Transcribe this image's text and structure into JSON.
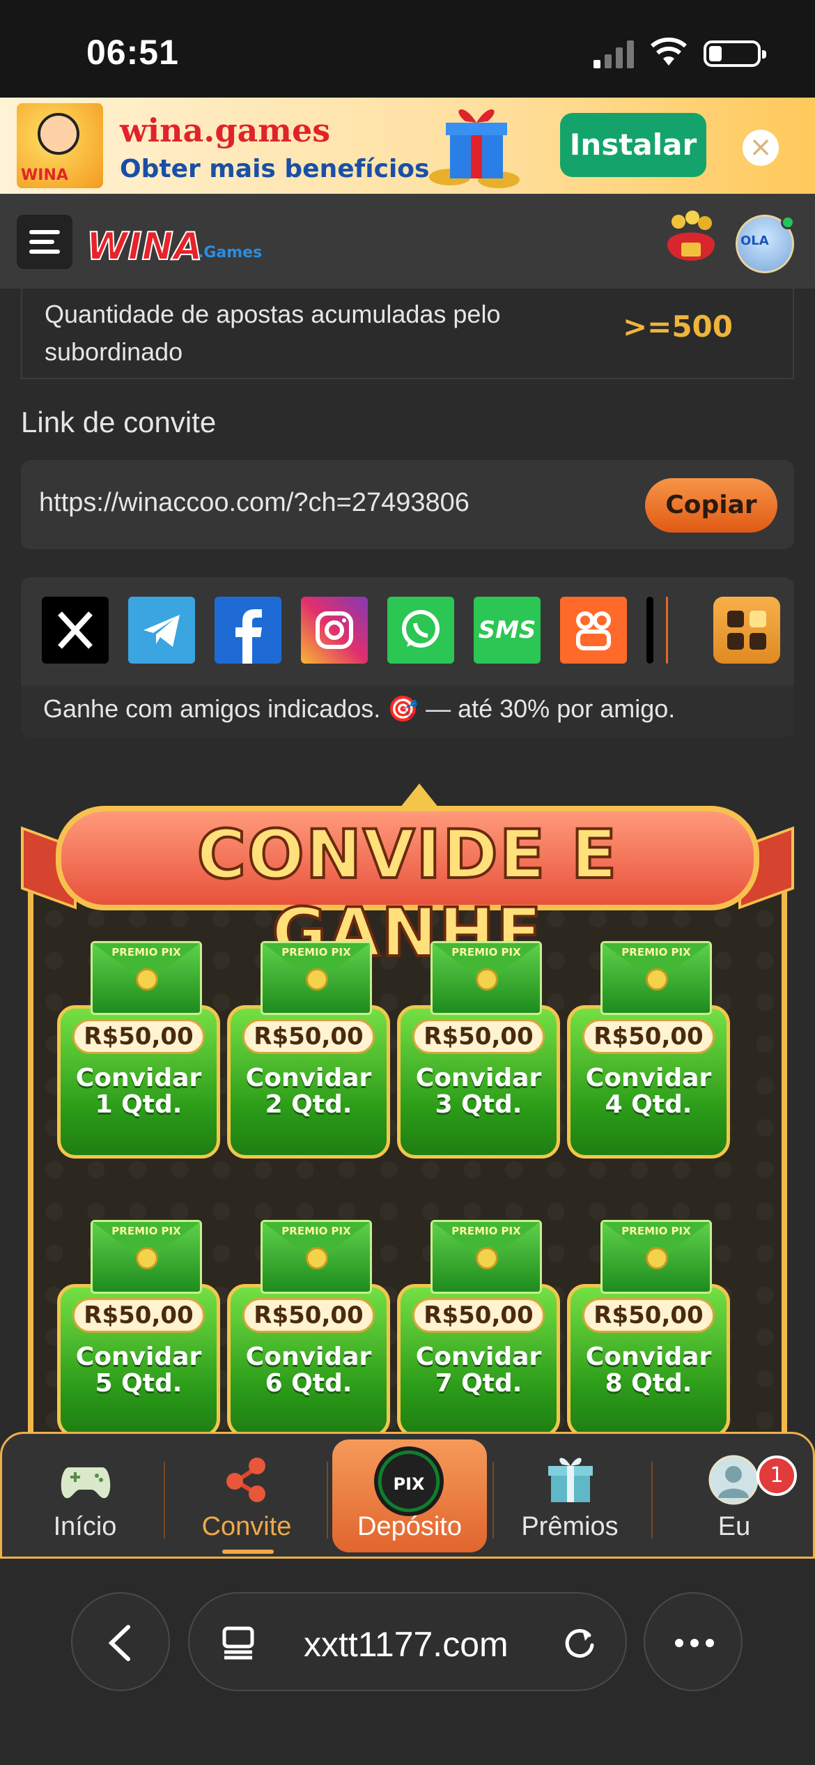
{
  "status_bar": {
    "time": "06:51"
  },
  "install_banner": {
    "app_name": "wina.games",
    "subtitle": "Obter mais benefícios",
    "install_label": "Instalar",
    "close_glyph": "×",
    "logo_text": "WINA"
  },
  "header": {
    "logo_text": "WINA",
    "logo_sub": ".Games",
    "avatar_text": "OLA"
  },
  "requirement": {
    "label": "Quantidade de apostas acumuladas pelo subordinado",
    "value": ">=500"
  },
  "invite_link": {
    "label": "Link de convite",
    "url": "https://winaccoo.com/?ch=27493806",
    "copy_label": "Copiar"
  },
  "share": {
    "icons": [
      "x-icon",
      "telegram-icon",
      "facebook-icon",
      "instagram-icon",
      "whatsapp-icon",
      "sms-icon",
      "kwai-icon",
      "more-apps-icon"
    ],
    "sms_text": "SMS",
    "caption": "Ganhe com amigos indicados. 🎯 — até 30% por amigo."
  },
  "promo": {
    "title": "CONVIDE E GANHE",
    "envelope_label": "PREMIO PIX",
    "prizes": [
      {
        "amount": "R$50,00",
        "line1": "Convidar",
        "line2": "1 Qtd."
      },
      {
        "amount": "R$50,00",
        "line1": "Convidar",
        "line2": "2 Qtd."
      },
      {
        "amount": "R$50,00",
        "line1": "Convidar",
        "line2": "3 Qtd."
      },
      {
        "amount": "R$50,00",
        "line1": "Convidar",
        "line2": "4 Qtd."
      },
      {
        "amount": "R$50,00",
        "line1": "Convidar",
        "line2": "5 Qtd."
      },
      {
        "amount": "R$50,00",
        "line1": "Convidar",
        "line2": "6 Qtd."
      },
      {
        "amount": "R$50,00",
        "line1": "Convidar",
        "line2": "7 Qtd."
      },
      {
        "amount": "R$50,00",
        "line1": "Convidar",
        "line2": "8 Qtd."
      }
    ]
  },
  "bottom_nav": {
    "items": [
      {
        "label": "Início",
        "icon": "gamepad-icon"
      },
      {
        "label": "Convite",
        "icon": "share-icon"
      },
      {
        "label": "Depósito",
        "icon": "pix-icon",
        "icon_text": "PIX"
      },
      {
        "label": "Prêmios",
        "icon": "gift-icon"
      },
      {
        "label": "Eu",
        "icon": "user-icon"
      }
    ],
    "active": "Convite",
    "badge_count": "1"
  },
  "browser": {
    "url": "xxtt1177.com"
  },
  "colors": {
    "accent": "#f0a84a",
    "install_green": "#14a46b",
    "value_gold": "#f0b43c"
  }
}
